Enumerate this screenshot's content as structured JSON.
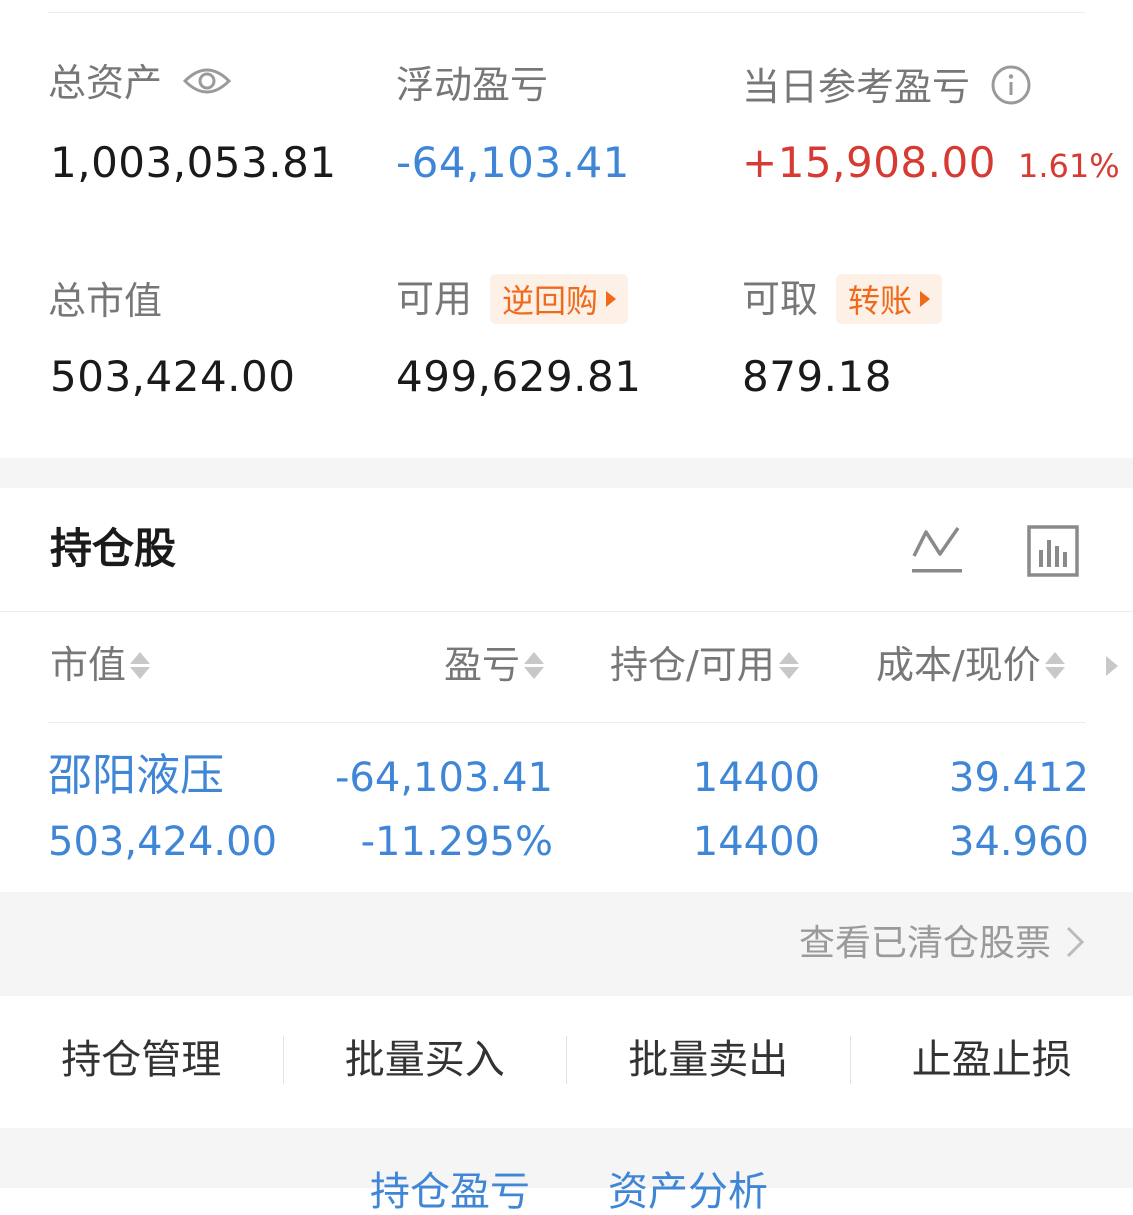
{
  "summary": {
    "total_assets": {
      "label": "总资产",
      "value": "1,003,053.81"
    },
    "floating_pl": {
      "label": "浮动盈亏",
      "value": "-64,103.41"
    },
    "daily_pl": {
      "label": "当日参考盈亏",
      "value": "+15,908.00",
      "percent": "1.61%"
    },
    "market_value": {
      "label": "总市值",
      "value": "503,424.00"
    },
    "available": {
      "label": "可用",
      "tag": "逆回购",
      "value": "499,629.81"
    },
    "withdrawable": {
      "label": "可取",
      "tag": "转账",
      "value": "879.18"
    }
  },
  "holdings": {
    "title": "持仓股",
    "columns": [
      "市值",
      "盈亏",
      "持仓/可用",
      "成本/现价"
    ],
    "rows": [
      {
        "name": "邵阳液压",
        "market_value": "503,424.00",
        "pl": "-64,103.41",
        "pl_pct": "-11.295%",
        "position": "14400",
        "available": "14400",
        "cost": "39.412",
        "price": "34.960"
      }
    ],
    "cleared_link": "查看已清仓股票"
  },
  "actions": [
    "持仓管理",
    "批量买入",
    "批量卖出",
    "止盈止损"
  ],
  "bottom_tabs": [
    "持仓盈亏",
    "资产分析"
  ],
  "colors": {
    "blue": "#3f86d6",
    "red": "#d63a32",
    "orange": "#f06a1c"
  }
}
